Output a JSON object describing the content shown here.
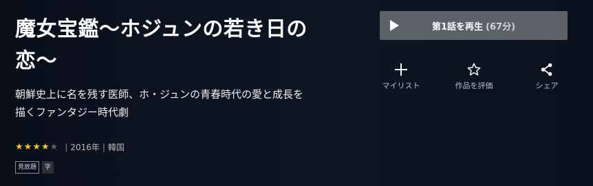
{
  "title": "魔女宝鑑～ホジュンの若き日の恋～",
  "description": "朝鮮史上に名を残す医師、ホ・ジュンの青春時代の愛と成長を描くファンタジー時代劇",
  "rating": {
    "value": 4,
    "max": 5
  },
  "year": "2016年",
  "country": "韓国",
  "badges": {
    "unlimited": "見放題",
    "subtitle": "字"
  },
  "play_button": {
    "label": "第1話を再生",
    "duration": "(67分)"
  },
  "actions": {
    "mylist": {
      "label": "マイリスト",
      "icon": "plus-icon"
    },
    "rate": {
      "label": "作品を評価",
      "icon": "star-outline-icon"
    },
    "share": {
      "label": "シェア",
      "icon": "share-icon"
    }
  },
  "colors": {
    "background": "#0b111d",
    "star": "#f5c518",
    "button": "#5d6269"
  }
}
